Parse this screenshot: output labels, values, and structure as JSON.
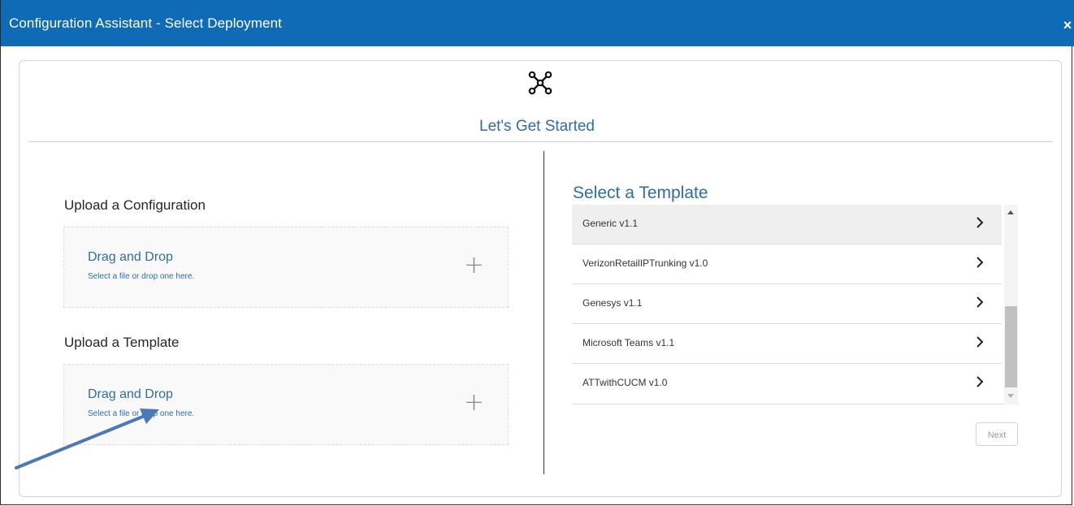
{
  "window": {
    "title": "Configuration Assistant - Select Deployment",
    "close_glyph": "×",
    "close_icon": "close-icon"
  },
  "header": {
    "icon": "network-hub-icon",
    "heading": "Let's Get Started"
  },
  "upload_configuration": {
    "label": "Upload a Configuration",
    "title": "Drag and Drop",
    "subtitle": "Select a file or drop one here.",
    "plus": "+"
  },
  "upload_template": {
    "label": "Upload a Template",
    "title": "Drag and Drop",
    "subtitle": "Select a file or drop one here.",
    "plus": "+"
  },
  "templates": {
    "heading": "Select a Template",
    "items": [
      {
        "name": "Generic v1.1",
        "selected": true
      },
      {
        "name": "VerizonRetailIPTrunking v1.0",
        "selected": false
      },
      {
        "name": "Genesys v1.1",
        "selected": false
      },
      {
        "name": "Microsoft Teams v1.1",
        "selected": false
      },
      {
        "name": "ATTwithCUCM v1.0",
        "selected": false
      }
    ]
  },
  "next_label": "Next",
  "colors": {
    "titlebar": "#0f6bb5",
    "accent_text": "#2e6da6",
    "annotation_arrow": "#4a78b8"
  }
}
